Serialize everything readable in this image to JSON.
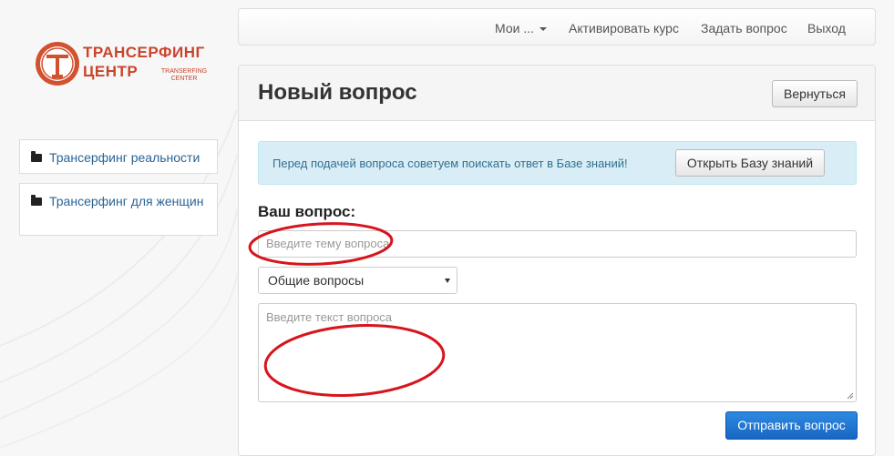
{
  "logo": {
    "line1": "ТРАНСЕРФИНГ",
    "line2": "ЦЕНТР",
    "sub1": "TRANSERFING",
    "sub2": "CENTER",
    "brand_color": "#c8442c"
  },
  "sidebar": {
    "items": [
      {
        "label": "Трансерфинг реальности",
        "icon": "folder-icon"
      },
      {
        "label": "Трансерфинг для женщин",
        "icon": "folder-icon"
      }
    ]
  },
  "navbar": {
    "my": "Мои ...",
    "activate": "Активировать курс",
    "ask": "Задать вопрос",
    "logout": "Выход"
  },
  "page": {
    "title": "Новый вопрос",
    "back_button": "Вернуться"
  },
  "alert": {
    "text": "Перед подачей вопроса советуем поискать ответ в Базе знаний!",
    "button": "Открыть Базу знаний"
  },
  "form": {
    "label": "Ваш вопрос:",
    "subject_placeholder": "Введите тему вопроса",
    "category_selected": "Общие вопросы",
    "body_placeholder": "Введите текст вопроса",
    "submit": "Отправить вопрос"
  },
  "colors": {
    "link": "#2a6496",
    "primary": "#1a6fc9",
    "alert_bg": "#d9edf7",
    "annotation": "#d8141c"
  }
}
